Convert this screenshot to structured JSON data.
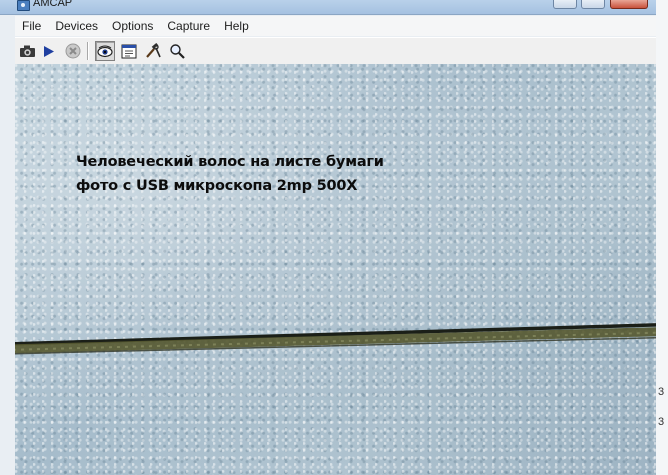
{
  "window": {
    "title": "AMCAP"
  },
  "menu": {
    "items": [
      "File",
      "Devices",
      "Options",
      "Capture",
      "Help"
    ]
  },
  "toolbar": {
    "buttons": [
      {
        "icon": "camera-icon",
        "state": "normal"
      },
      {
        "icon": "play-icon",
        "state": "normal"
      },
      {
        "icon": "stop-icon",
        "state": "disabled"
      },
      {
        "icon": "eye-icon",
        "state": "pressed"
      },
      {
        "icon": "preview-window-icon",
        "state": "normal"
      },
      {
        "icon": "tools-icon",
        "state": "normal"
      },
      {
        "icon": "zoom-icon",
        "state": "normal"
      }
    ]
  },
  "video": {
    "caption_line1": "Человеческий волос на листе бумаги",
    "caption_line2": "фото с USB микроскопа 2mp 500X"
  },
  "desktop_strip": {
    "chars": [
      "3",
      "3"
    ]
  },
  "colors": {
    "titlebar": "#b9d1ea",
    "hair": "#4a4a2a",
    "paper": "#b0c4d1"
  }
}
